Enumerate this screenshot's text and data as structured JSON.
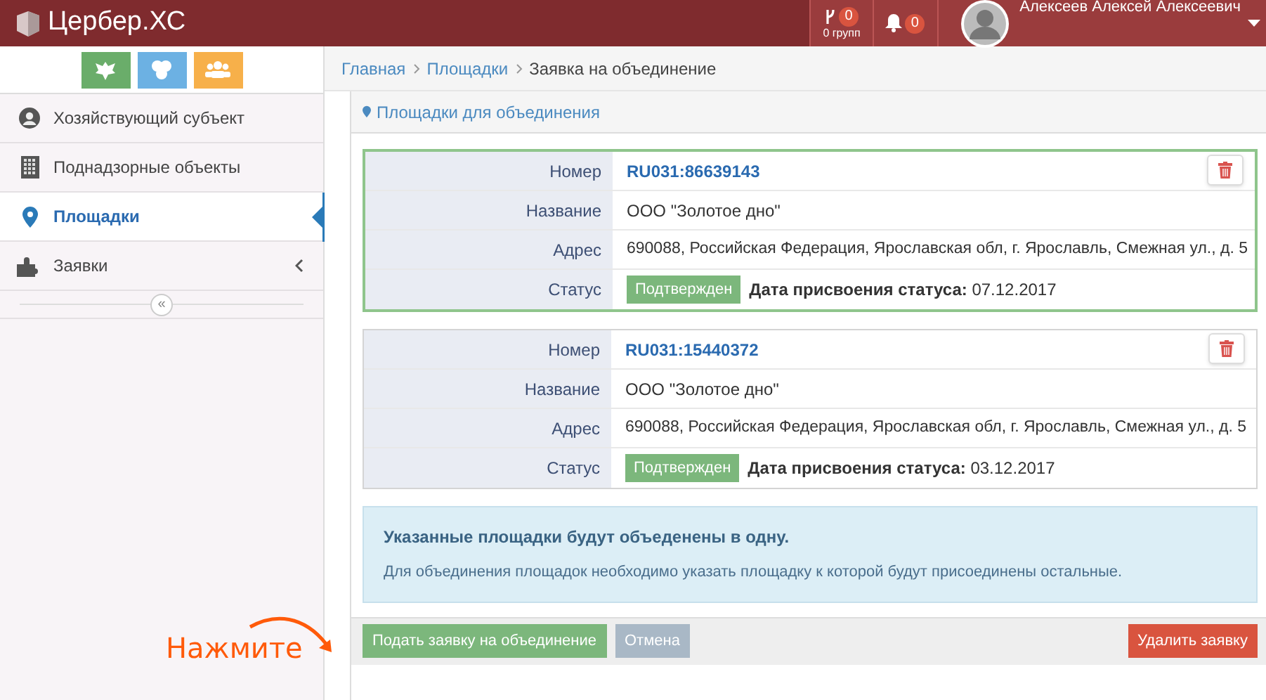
{
  "header": {
    "logo": "Цербер.ХС",
    "groups": {
      "count": "0",
      "label": "0 групп"
    },
    "notifications": {
      "count": "0"
    },
    "user": "Алексеев Алексей Алексеевич"
  },
  "sidebar": {
    "quick_buttons": [
      {
        "color": "#6aad6a"
      },
      {
        "color": "#6cb1e3"
      },
      {
        "color": "#f7b04a"
      }
    ],
    "items": [
      {
        "label": "Хозяйствующий субъект",
        "selected": false,
        "kind": "link"
      },
      {
        "label": "Поднадзорные объекты",
        "selected": false,
        "kind": "link"
      },
      {
        "label": "Площадки",
        "selected": true,
        "kind": "link"
      },
      {
        "label": "Заявки",
        "selected": false,
        "kind": "submenu"
      }
    ],
    "collapse": "«"
  },
  "breadcrumb": [
    {
      "label": "Главная",
      "kind": "link"
    },
    {
      "label": "Площадки",
      "kind": "link"
    },
    {
      "label": "Заявка на объединение",
      "kind": "current"
    }
  ],
  "panel": {
    "title": "Площадки для объединения",
    "sites": [
      {
        "selected": true,
        "number_label": "Номер",
        "number": "RU031:86639143",
        "name_label": "Название",
        "name": "ООО \"Золотое дно\"",
        "address_label": "Адрес",
        "address": "690088, Российская Федерация, Ярославская обл, г. Ярославль, Смежная ул., д. 5",
        "status_label": "Статус",
        "status": "Подтвержден",
        "date_label": "Дата присвоения статуса:",
        "date": "07.12.2017"
      },
      {
        "selected": false,
        "number_label": "Номер",
        "number": "RU031:15440372",
        "name_label": "Название",
        "name": "ООО \"Золотое дно\"",
        "address_label": "Адрес",
        "address": "690088, Российская Федерация, Ярославская обл, г. Ярославль, Смежная ул., д. 5",
        "status_label": "Статус",
        "status": "Подтвержден",
        "date_label": "Дата присвоения статуса:",
        "date": "03.12.2017"
      }
    ],
    "info": {
      "title": "Указанные площадки будут объеденены в одну.",
      "text": "Для объединения площадок необходимо указать площадку к которой будут присоединены остальные."
    },
    "buttons": [
      {
        "label": "Подать заявку на объединение",
        "kind": "primary"
      },
      {
        "label": "Отмена",
        "kind": "secondary"
      },
      {
        "label": "Удалить заявку",
        "kind": "danger"
      }
    ]
  },
  "annotation": "Нажмите"
}
